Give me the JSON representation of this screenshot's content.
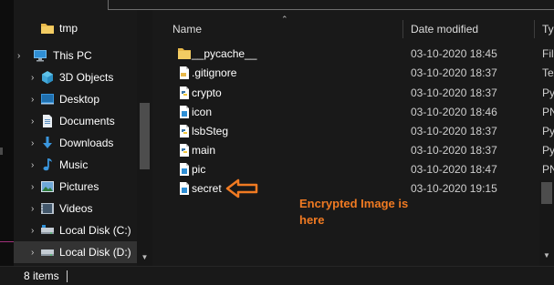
{
  "navigation": {
    "items": [
      {
        "label": "tmp",
        "icon": "folder-icon"
      },
      {
        "label": "This PC",
        "icon": "computer-icon"
      },
      {
        "label": "3D Objects",
        "icon": "cube-icon"
      },
      {
        "label": "Desktop",
        "icon": "desktop-icon"
      },
      {
        "label": "Documents",
        "icon": "documents-icon"
      },
      {
        "label": "Downloads",
        "icon": "download-icon"
      },
      {
        "label": "Music",
        "icon": "music-icon"
      },
      {
        "label": "Pictures",
        "icon": "pictures-icon"
      },
      {
        "label": "Videos",
        "icon": "videos-icon"
      },
      {
        "label": "Local Disk (C:)",
        "icon": "drive-icon"
      },
      {
        "label": "Local Disk (D:)",
        "icon": "drive-icon",
        "selected": true
      }
    ]
  },
  "columns": {
    "name": "Name",
    "date_modified": "Date modified",
    "type": "Typ"
  },
  "files": [
    {
      "name": "__pycache__",
      "date": "03-10-2020 18:45",
      "type": "Fil",
      "icon": "folder-icon"
    },
    {
      "name": ".gitignore",
      "date": "03-10-2020 18:37",
      "type": "Tex",
      "icon": "text-file-icon"
    },
    {
      "name": "crypto",
      "date": "03-10-2020 18:37",
      "type": "Py",
      "icon": "python-file-icon"
    },
    {
      "name": "icon",
      "date": "03-10-2020 18:46",
      "type": "PN",
      "icon": "image-file-icon"
    },
    {
      "name": "lsbSteg",
      "date": "03-10-2020 18:37",
      "type": "Py",
      "icon": "python-file-icon"
    },
    {
      "name": "main",
      "date": "03-10-2020 18:37",
      "type": "Py",
      "icon": "python-file-icon"
    },
    {
      "name": "pic",
      "date": "03-10-2020 18:47",
      "type": "PN",
      "icon": "image-file-icon"
    },
    {
      "name": "secret",
      "date": "03-10-2020 19:15",
      "type": "PN",
      "icon": "image-file-icon",
      "focused": true
    }
  ],
  "annotation": {
    "text": "Encrypted Image is\nhere",
    "color": "#f07a22"
  },
  "status": {
    "item_count": "8 items"
  },
  "colors": {
    "background": "#191919",
    "selected": "#333333",
    "folder": "#e8b84a",
    "accent_blue": "#3a96dd"
  }
}
